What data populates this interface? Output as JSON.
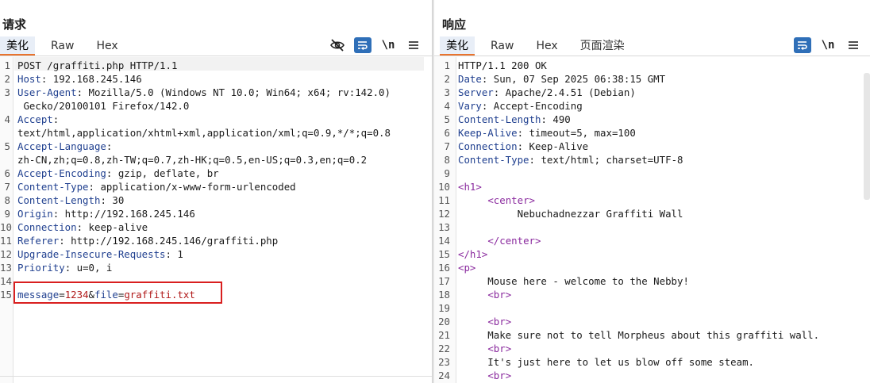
{
  "request": {
    "title": "请求",
    "tabs": [
      "美化",
      "Raw",
      "Hex"
    ],
    "active_tab": 0,
    "tool_newline": "\\n",
    "lines": [
      {
        "n": "1",
        "parts": [
          {
            "t": "POST /graffiti.php HTTP/1.1",
            "c": "hv"
          }
        ]
      },
      {
        "n": "2",
        "parts": [
          {
            "t": "Host",
            "c": "hk"
          },
          {
            "t": ": 192.168.245.146",
            "c": "hv"
          }
        ]
      },
      {
        "n": "3",
        "parts": [
          {
            "t": "User-Agent",
            "c": "hk"
          },
          {
            "t": ": Mozilla/5.0 (Windows NT 10.0; Win64; x64; rv:142.0)",
            "c": "hv"
          }
        ]
      },
      {
        "n": "",
        "parts": [
          {
            "t": " Gecko/20100101 Firefox/142.0",
            "c": "hv"
          }
        ]
      },
      {
        "n": "4",
        "parts": [
          {
            "t": "Accept",
            "c": "hk"
          },
          {
            "t": ":",
            "c": "hv"
          }
        ]
      },
      {
        "n": "",
        "parts": [
          {
            "t": "text/html,application/xhtml+xml,application/xml;q=0.9,*/*;q=0.8",
            "c": "hv"
          }
        ]
      },
      {
        "n": "5",
        "parts": [
          {
            "t": "Accept-Language",
            "c": "hk"
          },
          {
            "t": ":",
            "c": "hv"
          }
        ]
      },
      {
        "n": "",
        "parts": [
          {
            "t": "zh-CN,zh;q=0.8,zh-TW;q=0.7,zh-HK;q=0.5,en-US;q=0.3,en;q=0.2",
            "c": "hv"
          }
        ]
      },
      {
        "n": "6",
        "parts": [
          {
            "t": "Accept-Encoding",
            "c": "hk"
          },
          {
            "t": ": gzip, deflate, br",
            "c": "hv"
          }
        ]
      },
      {
        "n": "7",
        "parts": [
          {
            "t": "Content-Type",
            "c": "hk"
          },
          {
            "t": ": application/x-www-form-urlencoded",
            "c": "hv"
          }
        ]
      },
      {
        "n": "8",
        "parts": [
          {
            "t": "Content-Length",
            "c": "hk"
          },
          {
            "t": ": 30",
            "c": "hv"
          }
        ]
      },
      {
        "n": "9",
        "parts": [
          {
            "t": "Origin",
            "c": "hk"
          },
          {
            "t": ": http://192.168.245.146",
            "c": "hv"
          }
        ]
      },
      {
        "n": "10",
        "parts": [
          {
            "t": "Connection",
            "c": "hk"
          },
          {
            "t": ": keep-alive",
            "c": "hv"
          }
        ]
      },
      {
        "n": "11",
        "parts": [
          {
            "t": "Referer",
            "c": "hk"
          },
          {
            "t": ": http://192.168.245.146/graffiti.php",
            "c": "hv"
          }
        ]
      },
      {
        "n": "12",
        "parts": [
          {
            "t": "Upgrade-Insecure-Requests",
            "c": "hk"
          },
          {
            "t": ": 1",
            "c": "hv"
          }
        ]
      },
      {
        "n": "13",
        "parts": [
          {
            "t": "Priority",
            "c": "hk"
          },
          {
            "t": ": u=0, i",
            "c": "hv"
          }
        ]
      },
      {
        "n": "14",
        "parts": []
      },
      {
        "n": "15",
        "parts": [
          {
            "t": "message",
            "c": "pk"
          },
          {
            "t": "=",
            "c": "hv"
          },
          {
            "t": "1234",
            "c": "pv"
          },
          {
            "t": "&",
            "c": "hv"
          },
          {
            "t": "file",
            "c": "pk"
          },
          {
            "t": "=",
            "c": "hv"
          },
          {
            "t": "graffiti.txt",
            "c": "pv"
          }
        ]
      }
    ]
  },
  "response": {
    "title": "响应",
    "tabs": [
      "美化",
      "Raw",
      "Hex",
      "页面渲染"
    ],
    "active_tab": 0,
    "tool_newline": "\\n",
    "lines": [
      {
        "n": "1",
        "parts": [
          {
            "t": "HTTP/1.1 200 OK",
            "c": "hv"
          }
        ]
      },
      {
        "n": "2",
        "parts": [
          {
            "t": "Date",
            "c": "hk"
          },
          {
            "t": ": Sun, 07 Sep 2025 06:38:15 GMT",
            "c": "hv"
          }
        ]
      },
      {
        "n": "3",
        "parts": [
          {
            "t": "Server",
            "c": "hk"
          },
          {
            "t": ": Apache/2.4.51 (Debian)",
            "c": "hv"
          }
        ]
      },
      {
        "n": "4",
        "parts": [
          {
            "t": "Vary",
            "c": "hk"
          },
          {
            "t": ": Accept-Encoding",
            "c": "hv"
          }
        ]
      },
      {
        "n": "5",
        "parts": [
          {
            "t": "Content-Length",
            "c": "hk"
          },
          {
            "t": ": 490",
            "c": "hv"
          }
        ]
      },
      {
        "n": "6",
        "parts": [
          {
            "t": "Keep-Alive",
            "c": "hk"
          },
          {
            "t": ": timeout=5, max=100",
            "c": "hv"
          }
        ]
      },
      {
        "n": "7",
        "parts": [
          {
            "t": "Connection",
            "c": "hk"
          },
          {
            "t": ": Keep-Alive",
            "c": "hv"
          }
        ]
      },
      {
        "n": "8",
        "parts": [
          {
            "t": "Content-Type",
            "c": "hk"
          },
          {
            "t": ": text/html; charset=UTF-8",
            "c": "hv"
          }
        ]
      },
      {
        "n": "9",
        "parts": []
      },
      {
        "n": "10",
        "parts": [
          {
            "t": "<h1>",
            "c": "tag"
          }
        ]
      },
      {
        "n": "11",
        "parts": [
          {
            "t": "     ",
            "c": "txt"
          },
          {
            "t": "<center>",
            "c": "tag"
          }
        ]
      },
      {
        "n": "12",
        "parts": [
          {
            "t": "          Nebuchadnezzar Graffiti Wall",
            "c": "txt"
          }
        ]
      },
      {
        "n": "13",
        "parts": []
      },
      {
        "n": "14",
        "parts": [
          {
            "t": "     ",
            "c": "txt"
          },
          {
            "t": "</center>",
            "c": "tag"
          }
        ]
      },
      {
        "n": "15",
        "parts": [
          {
            "t": "</h1>",
            "c": "tag"
          }
        ]
      },
      {
        "n": "16",
        "parts": [
          {
            "t": "<p>",
            "c": "tag"
          }
        ]
      },
      {
        "n": "17",
        "parts": [
          {
            "t": "     Mouse here - welcome to the Nebby!",
            "c": "txt"
          }
        ]
      },
      {
        "n": "18",
        "parts": [
          {
            "t": "     ",
            "c": "txt"
          },
          {
            "t": "<br>",
            "c": "tag"
          }
        ]
      },
      {
        "n": "19",
        "parts": []
      },
      {
        "n": "20",
        "parts": [
          {
            "t": "     ",
            "c": "txt"
          },
          {
            "t": "<br>",
            "c": "tag"
          }
        ]
      },
      {
        "n": "21",
        "parts": [
          {
            "t": "     Make sure not to tell Morpheus about this graffiti wall.",
            "c": "txt"
          }
        ]
      },
      {
        "n": "22",
        "parts": [
          {
            "t": "     ",
            "c": "txt"
          },
          {
            "t": "<br>",
            "c": "tag"
          }
        ]
      },
      {
        "n": "23",
        "parts": [
          {
            "t": "     It's just here to let us blow off some steam.",
            "c": "txt"
          }
        ]
      },
      {
        "n": "24",
        "parts": [
          {
            "t": "     ",
            "c": "txt"
          },
          {
            "t": "<br>",
            "c": "tag"
          }
        ]
      }
    ]
  },
  "icons": {
    "hide": "eye-slash-icon",
    "wrap": "wrap-lines-icon",
    "menu": "hamburger-menu-icon",
    "layout_split": "split-columns-icon",
    "layout_rows": "split-rows-icon",
    "layout_single": "single-pane-icon"
  },
  "colors": {
    "accent": "#2f6fb8",
    "tab_underline": "#e8732e",
    "highlight_box": "#d91f1f",
    "header_key": "#1f3f8f",
    "param_value": "#b01818",
    "html_tag": "#8a2a9e"
  }
}
